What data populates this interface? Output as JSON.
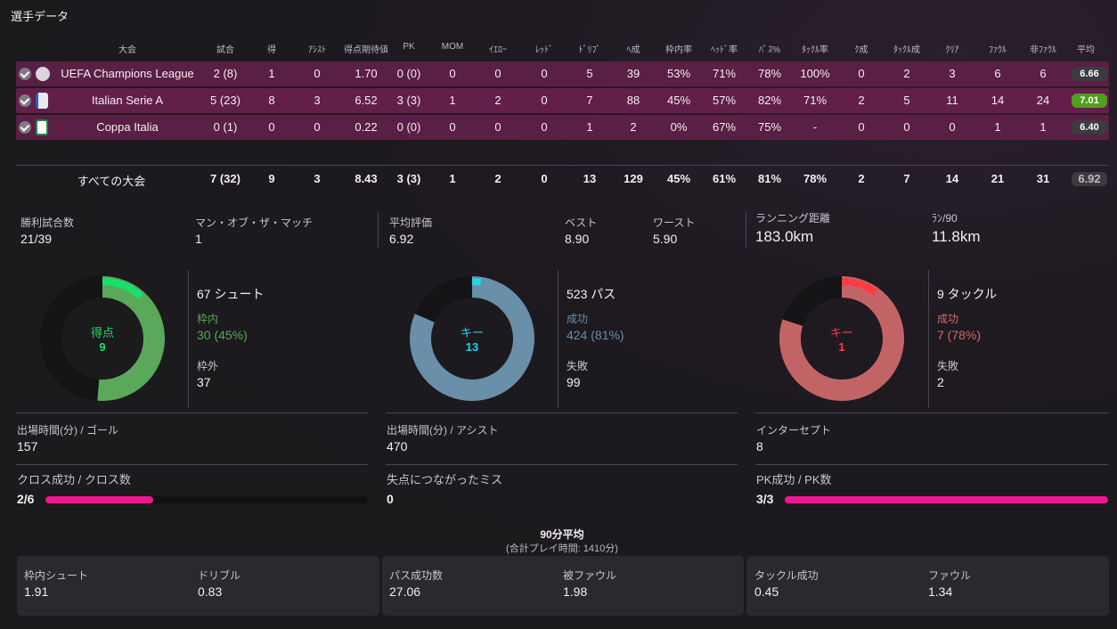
{
  "title": "選手データ",
  "table": {
    "headers": [
      "大会",
      "試合",
      "得",
      "ｱｼｽﾄ",
      "得点期待値",
      "PK",
      "MOM",
      "ｲｴﾛｰ",
      "ﾚｯﾄﾞ",
      "ﾄﾞﾘﾌﾞ",
      "ﾍ成",
      "枠内率",
      "ﾍｯﾄﾞ率",
      "ﾊﾟｽ%",
      "ﾀｯｸﾙ率",
      "ｸ成",
      "ﾀｯｸﾙ成",
      "ｸﾘｱ",
      "ﾌｧｳﾙ",
      "非ﾌｧｳﾙ",
      "平均"
    ],
    "rows": [
      {
        "competition": "UEFA Champions League",
        "cells": [
          "2 (8)",
          "1",
          "0",
          "1.70",
          "0 (0)",
          "0",
          "0",
          "0",
          "5",
          "39",
          "53%",
          "71%",
          "78%",
          "100%",
          "0",
          "2",
          "3",
          "6",
          "6"
        ],
        "rating": "6.66",
        "rating_color": "#3d3a40"
      },
      {
        "competition": "Italian Serie A",
        "cells": [
          "5 (23)",
          "8",
          "3",
          "6.52",
          "3 (3)",
          "1",
          "2",
          "0",
          "7",
          "88",
          "45%",
          "57%",
          "82%",
          "71%",
          "2",
          "5",
          "11",
          "14",
          "24"
        ],
        "rating": "7.01",
        "rating_color": "#4fa01d"
      },
      {
        "competition": "Coppa Italia",
        "cells": [
          "0 (1)",
          "0",
          "0",
          "0.22",
          "0 (0)",
          "0",
          "0",
          "0",
          "1",
          "2",
          "0%",
          "67%",
          "75%",
          "-",
          "0",
          "0",
          "0",
          "1",
          "1"
        ],
        "rating": "6.40",
        "rating_color": "#3d3a40"
      }
    ],
    "total": {
      "label": "すべての大会",
      "cells": [
        "7 (32)",
        "9",
        "3",
        "8.43",
        "3 (3)",
        "1",
        "2",
        "0",
        "13",
        "129",
        "45%",
        "61%",
        "81%",
        "78%",
        "2",
        "7",
        "14",
        "21",
        "31"
      ],
      "rating": "6.92"
    }
  },
  "summary": {
    "wins_label": "勝利試合数",
    "wins": "21/39",
    "mom_label": "マン・オブ・ザ・マッチ",
    "mom": "1",
    "avg_label": "平均評価",
    "avg": "6.92",
    "best_label": "ベスト",
    "best": "8.90",
    "worst_label": "ワースト",
    "worst": "5.90",
    "run_label": "ランニング距離",
    "run": "183.0km",
    "run90_label": "ﾗﾝ/90",
    "run90": "11.8km"
  },
  "chart_data": [
    {
      "type": "pie",
      "center_label": "得点",
      "center_value": "9",
      "total_label": "67 シュート",
      "values": [
        {
          "name": "得点",
          "value": 9,
          "color": "#19e06a"
        },
        {
          "name": "枠内",
          "value": 30,
          "color": "#5aa85a"
        },
        {
          "name": "枠外",
          "value": 37,
          "color": "#1b1a1d"
        }
      ],
      "stat1_label": "枠内",
      "stat1": "30 (45%)",
      "stat2_label": "枠外",
      "stat2": "37"
    },
    {
      "type": "pie",
      "center_label": "キー",
      "center_value": "13",
      "total_label": "523 パス",
      "values": [
        {
          "name": "キー",
          "value": 13,
          "color": "#23d4e8"
        },
        {
          "name": "成功",
          "value": 424,
          "color": "#6a8fa8"
        },
        {
          "name": "失敗",
          "value": 99,
          "color": "#1b1a1d"
        }
      ],
      "stat1_label": "成功",
      "stat1": "424 (81%)",
      "stat2_label": "失敗",
      "stat2": "99"
    },
    {
      "type": "pie",
      "center_label": "キー",
      "center_value": "1",
      "total_label": "9 タックル",
      "values": [
        {
          "name": "キー",
          "value": 1,
          "color": "#ff3b44"
        },
        {
          "name": "成功",
          "value": 7,
          "color": "#c26466"
        },
        {
          "name": "失敗",
          "value": 2,
          "color": "#1b1a1d"
        }
      ],
      "stat1_label": "成功",
      "stat1": "7 (78%)",
      "stat2_label": "失敗",
      "stat2": "2"
    }
  ],
  "minutes": {
    "goal_label": "出場時間(分) / ゴール",
    "goal": "157",
    "assist_label": "出場時間(分) / アシスト",
    "assist": "470",
    "intercept_label": "インターセプト",
    "intercept": "8"
  },
  "ratios": {
    "cross_label": "クロス成功 / クロス数",
    "cross": "2/6",
    "cross_frac": 0.333,
    "error_label": "失点につながったミス",
    "error": "0",
    "pk_label": "PK成功 / PK数",
    "pk": "3/3",
    "pk_frac": 1.0
  },
  "per90": {
    "title": "90分平均",
    "subtitle": "(合計プレイ時間: 1410分)",
    "items": [
      {
        "label": "枠内シュート",
        "value": "1.91"
      },
      {
        "label": "ドリブル",
        "value": "0.83"
      },
      {
        "label": "パス成功数",
        "value": "27.06"
      },
      {
        "label": "被ファウル",
        "value": "1.98"
      },
      {
        "label": "タックル成功",
        "value": "0.45"
      },
      {
        "label": "ファウル",
        "value": "1.34"
      }
    ]
  }
}
